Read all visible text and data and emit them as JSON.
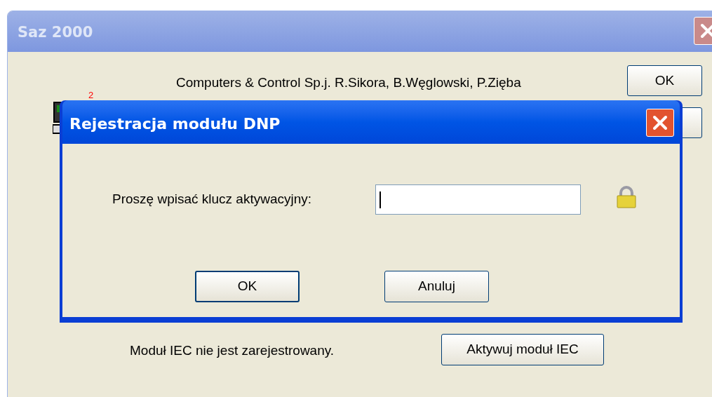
{
  "main_window": {
    "title": "Saz 2000",
    "company": "Computers & Control Sp.j. R.Sikora, B.Węglowski, P.Zięba",
    "ok_button": "OK",
    "badge": "2",
    "iec_status": "Moduł IEC nie jest zarejestrowany.",
    "iec_button": "Aktywuj moduł IEC"
  },
  "dialog": {
    "title": "Rejestracja modułu DNP",
    "prompt": "Proszę wpisać klucz aktywacyjny:",
    "buttons": [
      "OK",
      "Anuluj"
    ]
  }
}
